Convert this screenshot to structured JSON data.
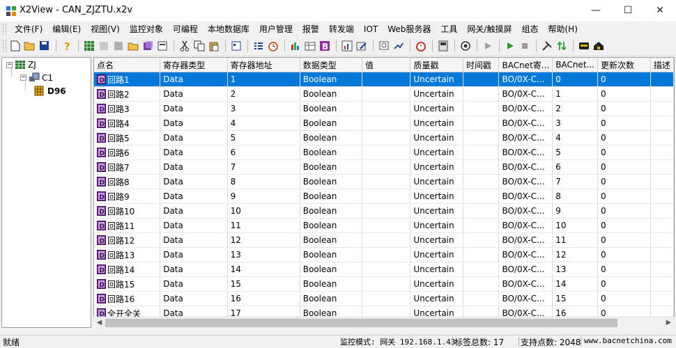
{
  "window": {
    "title": "X2View - CAN_ZJZTU.x2v",
    "minimize_icon": "—",
    "maximize_icon": "☐",
    "close_icon": "✕"
  },
  "menu": [
    {
      "label": "文件(F)"
    },
    {
      "label": "编辑(E)"
    },
    {
      "label": "视图(V)"
    },
    {
      "label": "监控对象"
    },
    {
      "label": "可编程"
    },
    {
      "label": "本地数据库"
    },
    {
      "label": "用户管理"
    },
    {
      "label": "报警"
    },
    {
      "label": "转发端"
    },
    {
      "label": "IOT"
    },
    {
      "label": "Web服务器"
    },
    {
      "label": "工具"
    },
    {
      "label": "网关/触摸屏"
    },
    {
      "label": "组态"
    },
    {
      "label": "帮助(H)"
    }
  ],
  "tree": {
    "root": {
      "label": "ZJ",
      "expander": "−"
    },
    "child": {
      "label": "C1",
      "expander": "−"
    },
    "leaf": {
      "label": "D96"
    }
  },
  "grid": {
    "columns": [
      "点名",
      "寄存器类型",
      "寄存器地址",
      "数据类型",
      "值",
      "质量戳",
      "时间戳",
      "BACnet寄...",
      "BACnet...",
      "更新次数",
      "描述"
    ],
    "rows": [
      {
        "name": "回路1",
        "reg_type": "Data",
        "addr": "1",
        "dtype": "Boolean",
        "value": "",
        "quality": "Uncertain",
        "time": "",
        "bac_obj": "BO/0X-C...",
        "bac_inst": "0",
        "updates": "0",
        "desc": ""
      },
      {
        "name": "回路2",
        "reg_type": "Data",
        "addr": "2",
        "dtype": "Boolean",
        "value": "",
        "quality": "Uncertain",
        "time": "",
        "bac_obj": "BO/0X-C...",
        "bac_inst": "1",
        "updates": "0",
        "desc": ""
      },
      {
        "name": "回路3",
        "reg_type": "Data",
        "addr": "3",
        "dtype": "Boolean",
        "value": "",
        "quality": "Uncertain",
        "time": "",
        "bac_obj": "BO/0X-C...",
        "bac_inst": "2",
        "updates": "0",
        "desc": ""
      },
      {
        "name": "回路4",
        "reg_type": "Data",
        "addr": "4",
        "dtype": "Boolean",
        "value": "",
        "quality": "Uncertain",
        "time": "",
        "bac_obj": "BO/0X-C...",
        "bac_inst": "3",
        "updates": "0",
        "desc": ""
      },
      {
        "name": "回路5",
        "reg_type": "Data",
        "addr": "5",
        "dtype": "Boolean",
        "value": "",
        "quality": "Uncertain",
        "time": "",
        "bac_obj": "BO/0X-C...",
        "bac_inst": "4",
        "updates": "0",
        "desc": ""
      },
      {
        "name": "回路6",
        "reg_type": "Data",
        "addr": "6",
        "dtype": "Boolean",
        "value": "",
        "quality": "Uncertain",
        "time": "",
        "bac_obj": "BO/0X-C...",
        "bac_inst": "5",
        "updates": "0",
        "desc": ""
      },
      {
        "name": "回路7",
        "reg_type": "Data",
        "addr": "7",
        "dtype": "Boolean",
        "value": "",
        "quality": "Uncertain",
        "time": "",
        "bac_obj": "BO/0X-C...",
        "bac_inst": "6",
        "updates": "0",
        "desc": ""
      },
      {
        "name": "回路8",
        "reg_type": "Data",
        "addr": "8",
        "dtype": "Boolean",
        "value": "",
        "quality": "Uncertain",
        "time": "",
        "bac_obj": "BO/0X-C...",
        "bac_inst": "7",
        "updates": "0",
        "desc": ""
      },
      {
        "name": "回路9",
        "reg_type": "Data",
        "addr": "9",
        "dtype": "Boolean",
        "value": "",
        "quality": "Uncertain",
        "time": "",
        "bac_obj": "BO/0X-C...",
        "bac_inst": "8",
        "updates": "0",
        "desc": ""
      },
      {
        "name": "回路10",
        "reg_type": "Data",
        "addr": "10",
        "dtype": "Boolean",
        "value": "",
        "quality": "Uncertain",
        "time": "",
        "bac_obj": "BO/0X-C...",
        "bac_inst": "9",
        "updates": "0",
        "desc": ""
      },
      {
        "name": "回路11",
        "reg_type": "Data",
        "addr": "11",
        "dtype": "Boolean",
        "value": "",
        "quality": "Uncertain",
        "time": "",
        "bac_obj": "BO/0X-C...",
        "bac_inst": "10",
        "updates": "0",
        "desc": ""
      },
      {
        "name": "回路12",
        "reg_type": "Data",
        "addr": "12",
        "dtype": "Boolean",
        "value": "",
        "quality": "Uncertain",
        "time": "",
        "bac_obj": "BO/0X-C...",
        "bac_inst": "11",
        "updates": "0",
        "desc": ""
      },
      {
        "name": "回路13",
        "reg_type": "Data",
        "addr": "13",
        "dtype": "Boolean",
        "value": "",
        "quality": "Uncertain",
        "time": "",
        "bac_obj": "BO/0X-C...",
        "bac_inst": "12",
        "updates": "0",
        "desc": ""
      },
      {
        "name": "回路14",
        "reg_type": "Data",
        "addr": "14",
        "dtype": "Boolean",
        "value": "",
        "quality": "Uncertain",
        "time": "",
        "bac_obj": "BO/0X-C...",
        "bac_inst": "13",
        "updates": "0",
        "desc": ""
      },
      {
        "name": "回路15",
        "reg_type": "Data",
        "addr": "15",
        "dtype": "Boolean",
        "value": "",
        "quality": "Uncertain",
        "time": "",
        "bac_obj": "BO/0X-C...",
        "bac_inst": "14",
        "updates": "0",
        "desc": ""
      },
      {
        "name": "回路16",
        "reg_type": "Data",
        "addr": "16",
        "dtype": "Boolean",
        "value": "",
        "quality": "Uncertain",
        "time": "",
        "bac_obj": "BO/0X-C...",
        "bac_inst": "15",
        "updates": "0",
        "desc": ""
      },
      {
        "name": "全开全关",
        "reg_type": "Data",
        "addr": "17",
        "dtype": "Boolean",
        "value": "",
        "quality": "Uncertain",
        "time": "",
        "bac_obj": "BO/0X-C...",
        "bac_inst": "16",
        "updates": "0",
        "desc": ""
      }
    ],
    "selected_row": 0,
    "selection_color": "#0078d7"
  },
  "scrollbar": {
    "left_arrow": "◀",
    "right_arrow": "▶"
  },
  "status": {
    "ready": "就绪",
    "mode": "监控模式: 网关 192.168.1.43",
    "tag_count": "标签总数: 17",
    "support_count": "支持点数: 2048",
    "website": "www.bacnetchina.com"
  },
  "toolbar_icons": [
    "new-icon",
    "open-icon",
    "save-icon",
    "help-icon",
    "grid-icon",
    "import-icon",
    "export-icon",
    "folder-add-icon",
    "cube-icon",
    "properties-icon",
    "cut-icon",
    "copy-icon",
    "paste-icon",
    "view-icon",
    "list-icon",
    "clock-icon",
    "bars-icon",
    "table-icon",
    "b-icon",
    "chart-icon",
    "edit-icon",
    "db-icon",
    "link-icon",
    "alarm-icon",
    "device-icon",
    "monitor-icon",
    "play-gray-icon",
    "play-icon",
    "stop-icon",
    "tools-icon",
    "arrows-icon",
    "screen-icon",
    "home-icon"
  ]
}
